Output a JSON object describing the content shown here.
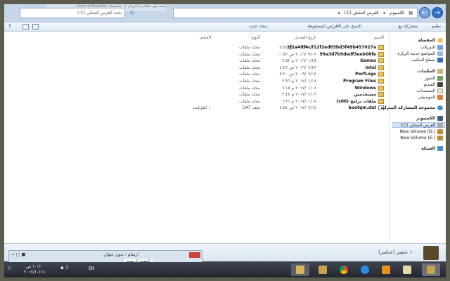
{
  "window": {
    "address_path": [
      "الكمبيوتر",
      "القرص المحلي (C:)"
    ],
    "search_placeholder": "بحث القرص المحلي (C:)",
    "glitch_text": "رمت مهر ساقتي (مكروني ) - ماسيسلاد Internet Explorer"
  },
  "toolbar": {
    "organize": "تنظيم",
    "share": "مشاركة مع",
    "burn": "النسخ على الأقراص المضغوطة",
    "new_folder": "مجلد جديد"
  },
  "columns": {
    "name": "الاسم",
    "date": "تاريخ التعديل",
    "type": "النوع",
    "size": "الحجم"
  },
  "files": [
    {
      "name": "3f1a48f4c712f2ed65bd3f49b457027a",
      "date": "٢٠١٥/٠١/٢٠ ص ٥:٥١",
      "type": "مجلد ملفات",
      "size": "",
      "icon": "folder"
    },
    {
      "name": "99a3d7b9dedf3eeb08fe",
      "date": "٢٠١٦/٠٩/٠٢ ص ١٠:٥٢",
      "type": "مجلد ملفات",
      "size": "",
      "icon": "folder"
    },
    {
      "name": "Games",
      "date": "٢٠١٦/٠١/٢٥ م ٧:٥٢",
      "type": "مجلد ملفات",
      "size": "",
      "icon": "folder"
    },
    {
      "name": "Intel",
      "date": "٢٠١٦/٠٧/٢٣ ص ٤:٤٣",
      "type": "مجلد ملفات",
      "size": "",
      "icon": "folder"
    },
    {
      "name": "PerfLogs",
      "date": "٢٠٠٩/٠٧/١٤ ص ٥:٢٠",
      "type": "مجلد ملفات",
      "size": "",
      "icon": "folder"
    },
    {
      "name": "Program Files",
      "date": "٢٠١٧/٠١/١٨ م ٢:٥٦",
      "type": "مجلد ملفات",
      "size": "",
      "icon": "folder"
    },
    {
      "name": "Windows",
      "date": "٢٠١٧/٠١/٠٨ م ٦:١٥",
      "type": "مجلد ملفات",
      "size": "",
      "icon": "folder"
    },
    {
      "name": "مستخدمين",
      "date": "٢٠١٧/٠٤/٠٢ م ٣:٤٤",
      "type": "مجلد ملفات",
      "size": "",
      "icon": "folder"
    },
    {
      "name": "ملفات برامج (x86)",
      "date": "٢٠١٧/٠١/٠٨ م ٦:٣١",
      "type": "مجلد ملفات",
      "size": "",
      "icon": "folder"
    },
    {
      "name": "bootqm.dat",
      "date": "٢٠١٧/٠٩/١٤ ص ٤:٥٤",
      "type": "ملف DAT",
      "size": "١ كيلوبايت",
      "icon": "file"
    }
  ],
  "nav": {
    "favorites": "المفضلة",
    "fav_items": [
      "التنزيلات",
      "المواضع حديثة الزيارة",
      "سطح المكتب"
    ],
    "libraries": "المكتبات",
    "lib_items": [
      "الصور",
      "الفيديو",
      "المستندات",
      "الموسيقى"
    ],
    "homegroup": "مجموعة المشاركة المنزلية",
    "computer": "الكمبيوتر",
    "drives": [
      "القرص المحلي (C:)",
      "New Volume (D:)",
      "New Volume (E:)"
    ],
    "network": "الشبكة"
  },
  "details": {
    "item_count": "١٠ عنصر (عناصر)"
  },
  "popup": {
    "title": "ارسام - بدون عنوان",
    "info": "الصفحة الرئيسية"
  },
  "taskbar": {
    "time": "١٠:٣٠ ص",
    "date": "٢٠١٧/١٠/١٤",
    "lang": "EN"
  },
  "colors": {
    "accent": "#2e6fc7",
    "folder": "#e8c25b",
    "taskbar": "#2b2f38"
  }
}
